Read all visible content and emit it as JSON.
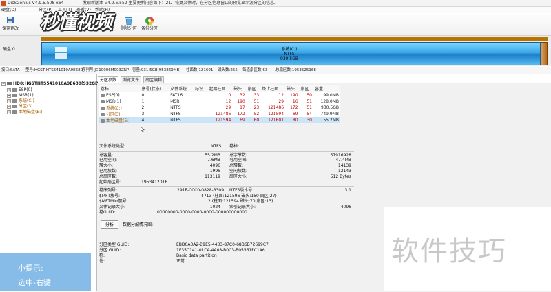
{
  "titlebar": {
    "title": "DiskGenius V4.9.5.508 x64",
    "message": "发现新版本 V4.9.6.552 主要更新内容如下：21、恢复文件时，在分区信息窗口的预览显示源分区的信息。"
  },
  "menu": [
    "硬盘(D)",
    "分区(P)",
    "工具(T)",
    "查看(V)",
    "帮助(H)"
  ],
  "toolbar": {
    "save_label": "保存更改",
    "format_label": "格式化",
    "delete_label": "删除分区",
    "backup_label": "备份分区",
    "logo_text": "秒懂视频"
  },
  "diskbar": {
    "disk_label": "硬盘 0",
    "partition_name": "系统(C:)",
    "fs": "NTFS",
    "size": "930.5GB"
  },
  "infobar": {
    "interface": "接口:SATA",
    "model": "型号:HGST HTS541010A9E680",
    "serial": "序列号:JD10006M003ZNP",
    "capacity": "容量:931.5GB(953869MB)",
    "cylinders": "柱面数:121601",
    "heads": "磁头数:255",
    "sectors_per_track": "每道扇区数:63",
    "total_sectors": "总扇区数:1953525168"
  },
  "tree": {
    "disk": "HD0:HGSTHTS541010A9E680(932GB)",
    "items": [
      "ESP(0)",
      "MSR(1)",
      "系统(C:)",
      "分区(3)",
      "本地磁盘(E:)"
    ]
  },
  "tabs": [
    "分区参数",
    "浏览文件",
    "扇区编辑"
  ],
  "table": {
    "headers": [
      "卷标",
      "序号(状态)",
      "文件系统",
      "标识",
      "起始柱面",
      "磁头",
      "扇区",
      "终止柱面",
      "磁头",
      "扇区",
      "容量"
    ],
    "rows": [
      {
        "label": "ESP(0)",
        "idx": "0",
        "fs": "FAT16",
        "flag": "",
        "sc": "0",
        "sh": "32",
        "ss": "33",
        "ec": "12",
        "eh": "190",
        "es": "50",
        "size": "99.0MB"
      },
      {
        "label": "MSR(1)",
        "idx": "1",
        "fs": "MSR",
        "flag": "",
        "sc": "12",
        "sh": "190",
        "ss": "51",
        "ec": "29",
        "eh": "16",
        "es": "51",
        "size": "128.0MB"
      },
      {
        "label": "系统(C:)",
        "idx": "2",
        "fs": "NTFS",
        "flag": "",
        "sc": "29",
        "sh": "17",
        "ss": "23",
        "ec": "121486",
        "eh": "172",
        "es": "51",
        "size": "930.5GB"
      },
      {
        "label": "分区(3)",
        "idx": "3",
        "fs": "NTFS",
        "flag": "",
        "sc": "121486",
        "sh": "172",
        "ss": "52",
        "ec": "121594",
        "eh": "69",
        "es": "54",
        "size": "749.9MB"
      },
      {
        "label": "本地磁盘(E:)",
        "idx": "4",
        "fs": "NTFS",
        "flag": "",
        "sc": "121594",
        "sh": "69",
        "ss": "60",
        "ec": "121601",
        "eh": "80",
        "es": "30",
        "size": "55.2MB"
      }
    ]
  },
  "details": {
    "fs_type_label": "文件系统类型:",
    "fs_type": "NTFS",
    "volume_label": "卷标:",
    "total_cap_label": "总容量:",
    "total_cap": "55.2MB",
    "total_bytes_label": "总字节数:",
    "total_bytes": "57916928",
    "free_label": "已用空间:",
    "free": "7.6MB",
    "avail_label": "可用空间:",
    "avail": "47.4MB",
    "cluster_label": "簇大小:",
    "cluster": "4096",
    "total_clusters_label": "总簇数:",
    "total_clusters": "14139",
    "used_clusters_label": "已用簇数:",
    "used_clusters": "1996",
    "free_clusters_label": "空闲簇数:",
    "free_clusters": "12143",
    "sectors_label": "总扇区数:",
    "sectors": "113119",
    "sector_size_label": "扇区大小:",
    "sector_size": "512 Bytes",
    "start_sector_label": "起始扇区号:",
    "start_sector": "1953412016",
    "serial_label": "卷序列号:",
    "serial": "291F-C0C0-0828-B309",
    "ntfs_ver_label": "NTFS版本号:",
    "ntfs_ver": "3.1",
    "mft_label": "$MFT簇号:",
    "mft": "4713 (柱面:121596 磁头:150 扇区:27)",
    "mftmirr_label": "$MFTMirr簇号:",
    "mftmirr": "2 (柱面:121594 磁头:70 扇区:13)",
    "record_label": "文件记录大小:",
    "record": "1024",
    "index_label": "索引记录大小:",
    "index": "4096",
    "guid_label": "卷GUID:",
    "guid": "00000000-0000-0000-0000-000000000000",
    "analyze": "分析",
    "alloc_label": "数据分配情况图:",
    "type_guid_label": "分区类型 GUID:",
    "type_guid": "EBD0A0A2-B9E5-4433-87C0-68B6B72699C7",
    "part_guid_label": "分区 GUID:",
    "part_guid": "1F35C141-01CA-4A08-B0C3-B05561FC1A6",
    "name_label": "称:",
    "name": "Basic data partition",
    "attr_label": "性:",
    "attr": "正常"
  },
  "overlay": {
    "tip_title": "小提示:",
    "tip_body": "选中-右键",
    "corner_text": "软件技巧"
  }
}
